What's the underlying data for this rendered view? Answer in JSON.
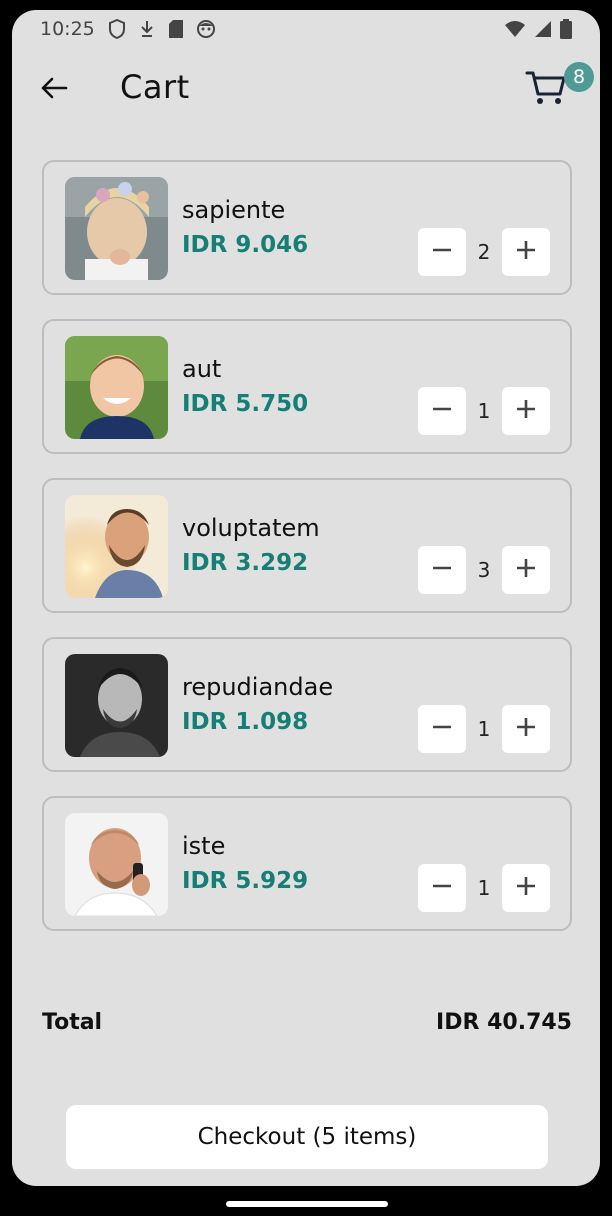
{
  "status_bar": {
    "time": "10:25",
    "left_icons": [
      "shield-icon",
      "download-icon",
      "sd-card-icon",
      "face-icon"
    ],
    "right_icons": [
      "wifi-icon",
      "signal-icon",
      "battery-icon"
    ]
  },
  "app_bar": {
    "title": "Cart",
    "back_icon": "arrow-left-icon",
    "cart_icon": "shopping-cart-icon",
    "cart_badge": "8"
  },
  "colors": {
    "price": "#157f75",
    "badge": "#4f9a95",
    "background": "#e0e0e0",
    "card_border": "#bdbdbd"
  },
  "items": [
    {
      "name": "sapiente",
      "price": "IDR 9.046",
      "quantity": "2"
    },
    {
      "name": "aut",
      "price": "IDR 5.750",
      "quantity": "1"
    },
    {
      "name": "voluptatem",
      "price": "IDR 3.292",
      "quantity": "3"
    },
    {
      "name": "repudiandae",
      "price": "IDR 1.098",
      "quantity": "1"
    },
    {
      "name": "iste",
      "price": "IDR 5.929",
      "quantity": "1"
    }
  ],
  "summary": {
    "total_label": "Total",
    "total_value": "IDR 40.745"
  },
  "checkout": {
    "label": "Checkout (5 items)"
  }
}
